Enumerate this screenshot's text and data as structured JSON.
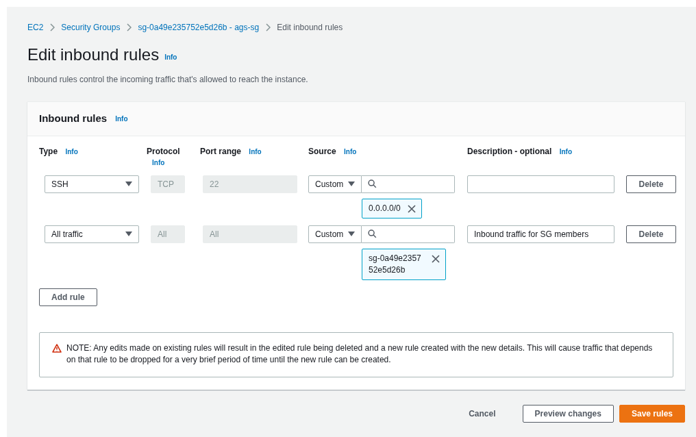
{
  "breadcrumbs": [
    {
      "label": "EC2",
      "kind": "link"
    },
    {
      "label": "Security Groups",
      "kind": "link"
    },
    {
      "label": "sg-0a49e235752e5d26b - ags-sg",
      "kind": "link"
    },
    {
      "label": "Edit inbound rules",
      "kind": "current"
    }
  ],
  "page": {
    "title": "Edit inbound rules",
    "info": "Info",
    "description": "Inbound rules control the incoming traffic that's allowed to reach the instance."
  },
  "panel": {
    "title": "Inbound rules",
    "info": "Info",
    "columns": [
      {
        "label": "Type",
        "info": "Info"
      },
      {
        "label": "Protocol",
        "info": "Info"
      },
      {
        "label": "Port range",
        "info": "Info"
      },
      {
        "label": "Source",
        "info": "Info"
      },
      {
        "label": "Description - optional",
        "info": "Info"
      }
    ],
    "rules": [
      {
        "type": "SSH",
        "protocol": {
          "value": "TCP",
          "disabled": true
        },
        "port_range": {
          "value": "22",
          "disabled": true
        },
        "source_type": "Custom",
        "tokens": [
          "0.0.0.0/0"
        ],
        "delete": "Delete"
      },
      {
        "type": "All traffic",
        "protocol": {
          "value": "All",
          "disabled": true
        },
        "port_range": {
          "value": "All",
          "disabled": true
        },
        "source_type": "Custom",
        "tokens": [
          "sg-0a49e2357 52e5d26b"
        ],
        "description": "Inbound traffic for SG members",
        "delete": "Delete"
      }
    ],
    "add_button": "Add rule",
    "note": "NOTE: Any edits made on existing rules will result in the edited rule being deleted and a new rule created with the new details. This will cause traffic that depends on that rule to be dropped for a very brief period of time until the new rule can be created."
  },
  "footer": [
    {
      "label": "Cancel",
      "kind": "link"
    },
    {
      "label": "Preview changes",
      "kind": "secondary"
    },
    {
      "label": "Save rules",
      "kind": "primary"
    }
  ]
}
